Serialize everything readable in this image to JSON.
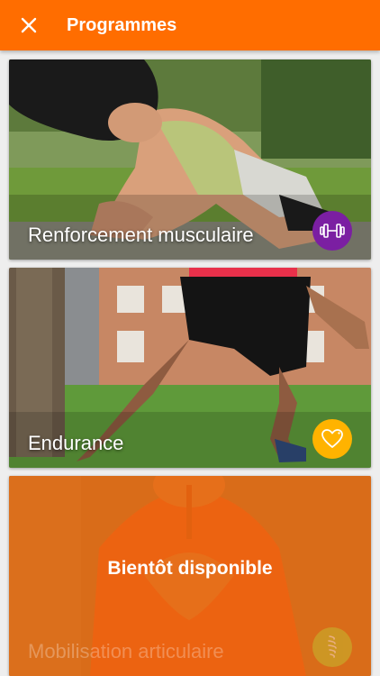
{
  "header": {
    "title": "Programmes",
    "close_icon": "close-icon",
    "background": "#ff6d00"
  },
  "programmes": [
    {
      "label": "Renforcement musculaire",
      "icon": "dumbbell-icon",
      "badge_color": "#7b1fa2",
      "available": true
    },
    {
      "label": "Endurance",
      "icon": "heart-icon",
      "badge_color": "#ffb300",
      "available": true
    },
    {
      "label": "Mobilisation articulaire",
      "icon": "spine-icon",
      "badge_color": "#c0ca33",
      "available": false,
      "status": "Bientôt disponible"
    }
  ]
}
